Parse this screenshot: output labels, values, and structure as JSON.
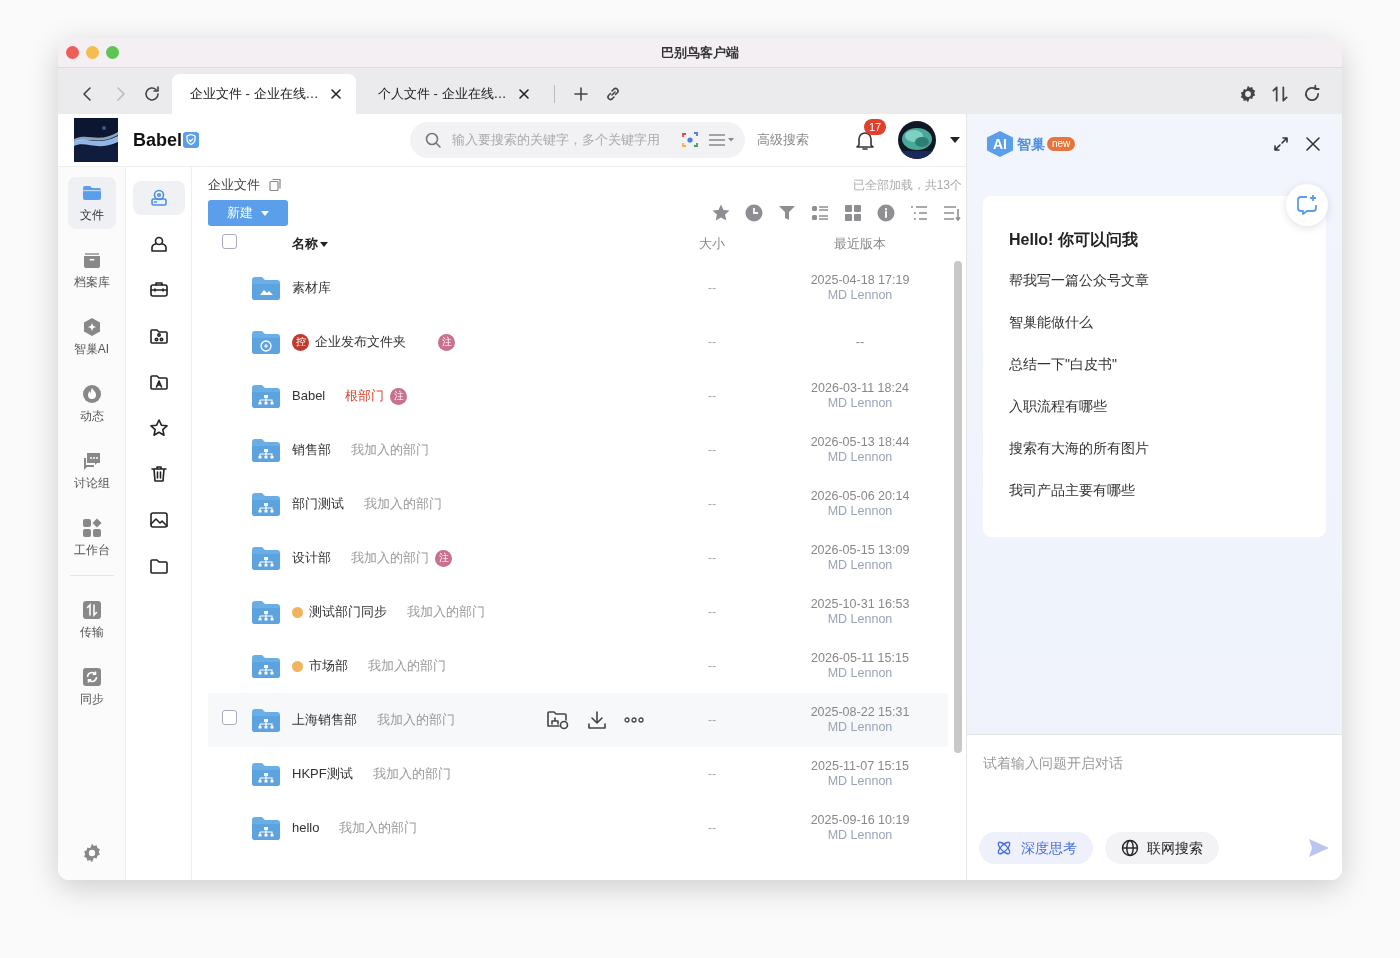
{
  "window": {
    "title": "巴别鸟客户端"
  },
  "nav": {
    "back_disabled": false,
    "forward_disabled": true
  },
  "tabs": [
    {
      "label": "企业文件 - 企业在线…",
      "selected": true
    },
    {
      "label": "个人文件 - 企业在线…",
      "selected": false
    }
  ],
  "header": {
    "brand": "Babel",
    "search": {
      "placeholder": "输入要搜索的关键字，多个关键字用"
    },
    "advanced_search": "高级搜索",
    "notifications": "17"
  },
  "sidebar": {
    "items": [
      {
        "label": "文件",
        "selected": true
      },
      {
        "label": "档案库",
        "selected": false
      },
      {
        "label": "智巢AI",
        "selected": false
      },
      {
        "label": "动态",
        "selected": false
      },
      {
        "label": "讨论组",
        "selected": false
      },
      {
        "label": "工作台",
        "selected": false
      },
      {
        "label": "传输",
        "selected": false
      },
      {
        "label": "同步",
        "selected": false
      }
    ]
  },
  "subnav": {
    "items": [
      {
        "selected": true
      },
      {
        "selected": false
      },
      {
        "selected": false
      },
      {
        "selected": false
      },
      {
        "selected": false
      },
      {
        "selected": false
      },
      {
        "selected": false
      },
      {
        "selected": false
      },
      {
        "selected": false
      }
    ]
  },
  "breadcrumb": "企业文件",
  "load_status": "已全部加载，共13个",
  "new_button": "新建",
  "table": {
    "select_all_checked": false,
    "columns": [
      "名称",
      "大小",
      "最近版本"
    ],
    "rows": [
      {
        "kind": "library",
        "name": "素材库",
        "size": "--",
        "date": "2025-04-18 17:19",
        "author": "MD Lennon",
        "hovered": false,
        "checked": false
      },
      {
        "kind": "publish",
        "lock_badge": "控",
        "name": "企业发布文件夹",
        "note_badge": "注",
        "size": "--",
        "date": "--",
        "hovered": false,
        "checked": false
      },
      {
        "kind": "department",
        "name": "Babel",
        "tag": {
          "text": "根部门",
          "kind": "root",
          "note_badge": "注"
        },
        "size": "--",
        "date": "2026-03-11 18:24",
        "author": "MD Lennon",
        "hovered": false,
        "checked": false
      },
      {
        "kind": "department",
        "name": "销售部",
        "tag": {
          "text": "我加入的部门",
          "kind": "member"
        },
        "size": "--",
        "date": "2026-05-13 18:44",
        "author": "MD Lennon",
        "hovered": false,
        "checked": false
      },
      {
        "kind": "department",
        "name": "部门测试",
        "tag": {
          "text": "我加入的部门",
          "kind": "member"
        },
        "size": "--",
        "date": "2026-05-06 20:14",
        "author": "MD Lennon",
        "hovered": false,
        "checked": false
      },
      {
        "kind": "department",
        "name": "设计部",
        "tag": {
          "text": "我加入的部门",
          "kind": "member",
          "note_badge": "注"
        },
        "size": "--",
        "date": "2026-05-15 13:09",
        "author": "MD Lennon",
        "hovered": false,
        "checked": false
      },
      {
        "kind": "department",
        "color": "#f0b45e",
        "name": "测试部门同步",
        "tag": {
          "text": "我加入的部门",
          "kind": "member"
        },
        "size": "--",
        "date": "2025-10-31 16:53",
        "author": "MD Lennon",
        "hovered": false,
        "checked": false
      },
      {
        "kind": "department",
        "color": "#f0b45e",
        "name": "市场部",
        "tag": {
          "text": "我加入的部门",
          "kind": "member"
        },
        "size": "--",
        "date": "2026-05-11 15:15",
        "author": "MD Lennon",
        "hovered": false,
        "checked": false
      },
      {
        "kind": "department",
        "name": "上海销售部",
        "tag": {
          "text": "我加入的部门",
          "kind": "member"
        },
        "size": "--",
        "date": "2025-08-22 15:31",
        "author": "MD Lennon",
        "hovered": true,
        "checked": false
      },
      {
        "kind": "department",
        "name": "HKPF测试",
        "tag": {
          "text": "我加入的部门",
          "kind": "member"
        },
        "size": "--",
        "date": "2025-11-07 15:15",
        "author": "MD Lennon",
        "hovered": false,
        "checked": false
      },
      {
        "kind": "department",
        "name": "hello",
        "tag": {
          "text": "我加入的部门",
          "kind": "member"
        },
        "size": "--",
        "date": "2025-09-16 10:19",
        "author": "MD Lennon",
        "hovered": false,
        "checked": false
      }
    ]
  },
  "assistant": {
    "logo_text": "AI",
    "title": "智巢",
    "badge": "new",
    "greeting": "Hello! 你可以问我",
    "suggestions": [
      "帮我写一篇公众号文章",
      "智巢能做什么",
      "总结一下\"白皮书\"",
      "入职流程有哪些",
      "搜索有大海的所有图片",
      "我司产品主要有哪些"
    ],
    "input": {
      "placeholder": "试着输入问题开启对话"
    },
    "options": [
      {
        "label": "深度思考",
        "selected": true
      },
      {
        "label": "联网搜索",
        "selected": false
      }
    ]
  }
}
